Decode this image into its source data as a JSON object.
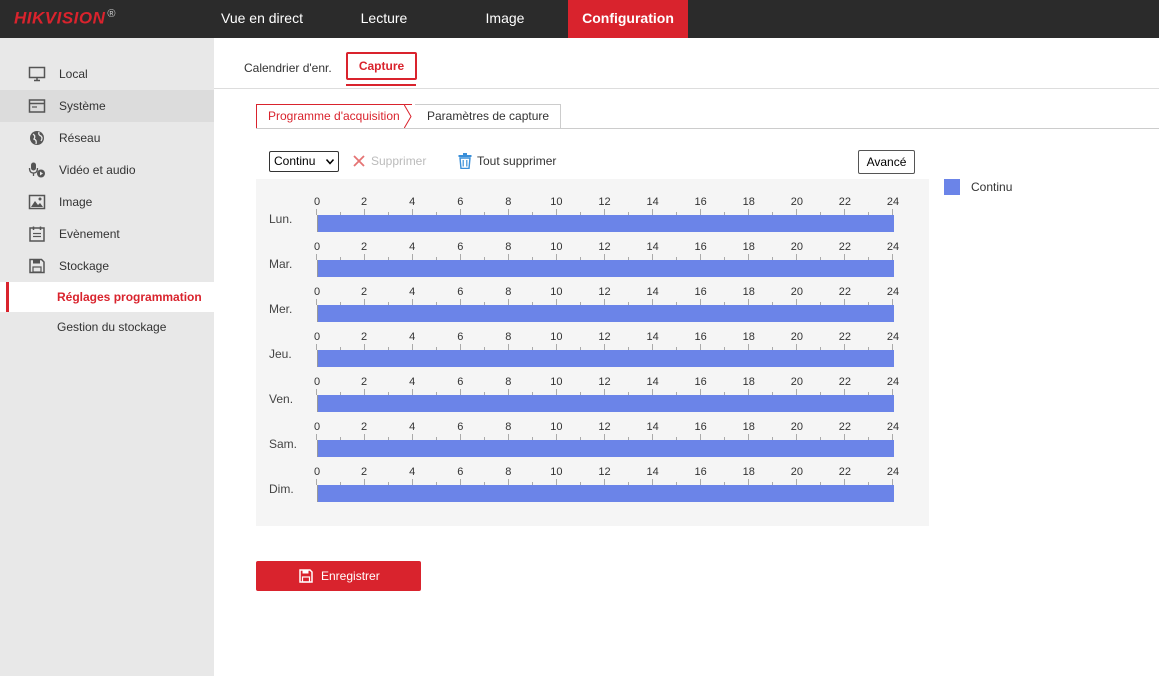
{
  "brand": {
    "name": "HIKVISION",
    "mark": "®"
  },
  "topnav": [
    {
      "label": "Vue en direct"
    },
    {
      "label": "Lecture"
    },
    {
      "label": "Image"
    },
    {
      "label": "Configuration",
      "active": true
    }
  ],
  "sidebar": {
    "items": [
      {
        "label": "Local",
        "icon": "monitor-icon"
      },
      {
        "label": "Système",
        "icon": "window-icon"
      },
      {
        "label": "Réseau",
        "icon": "globe-icon"
      },
      {
        "label": "Vidéo et audio",
        "icon": "microphone-icon"
      },
      {
        "label": "Image",
        "icon": "picture-icon"
      },
      {
        "label": "Evènement",
        "icon": "calendar-icon"
      },
      {
        "label": "Stockage",
        "icon": "floppy-icon"
      }
    ],
    "subitems": [
      {
        "label": "Réglages programmation",
        "active": true
      },
      {
        "label": "Gestion du stockage"
      }
    ]
  },
  "tabs": [
    {
      "label": "Calendrier d'enr."
    },
    {
      "label": "Capture",
      "active": true
    }
  ],
  "subtabs": [
    {
      "label": "Programme d'acquisition",
      "active": true
    },
    {
      "label": "Paramètres de capture"
    }
  ],
  "toolbar": {
    "mode_select": "Continu",
    "delete_label": "Supprimer",
    "delete_all_label": "Tout supprimer",
    "advanced_label": "Avancé"
  },
  "schedule": {
    "ticks": [
      "0",
      "2",
      "4",
      "6",
      "8",
      "10",
      "12",
      "14",
      "16",
      "18",
      "20",
      "22",
      "24"
    ],
    "days": [
      {
        "label": "Lun.",
        "segments": [
          {
            "start": 0,
            "end": 24,
            "type": "Continu"
          }
        ]
      },
      {
        "label": "Mar.",
        "segments": [
          {
            "start": 0,
            "end": 24,
            "type": "Continu"
          }
        ]
      },
      {
        "label": "Mer.",
        "segments": [
          {
            "start": 0,
            "end": 24,
            "type": "Continu"
          }
        ]
      },
      {
        "label": "Jeu.",
        "segments": [
          {
            "start": 0,
            "end": 24,
            "type": "Continu"
          }
        ]
      },
      {
        "label": "Ven.",
        "segments": [
          {
            "start": 0,
            "end": 24,
            "type": "Continu"
          }
        ]
      },
      {
        "label": "Sam.",
        "segments": [
          {
            "start": 0,
            "end": 24,
            "type": "Continu"
          }
        ]
      },
      {
        "label": "Dim.",
        "segments": [
          {
            "start": 0,
            "end": 24,
            "type": "Continu"
          }
        ]
      }
    ]
  },
  "legend": [
    {
      "label": "Continu",
      "color": "#6b84e8"
    }
  ],
  "save_label": "Enregistrer",
  "colors": {
    "accent": "#d9232d",
    "topbar": "#2b2b2b",
    "continuous": "#6b84e8"
  }
}
